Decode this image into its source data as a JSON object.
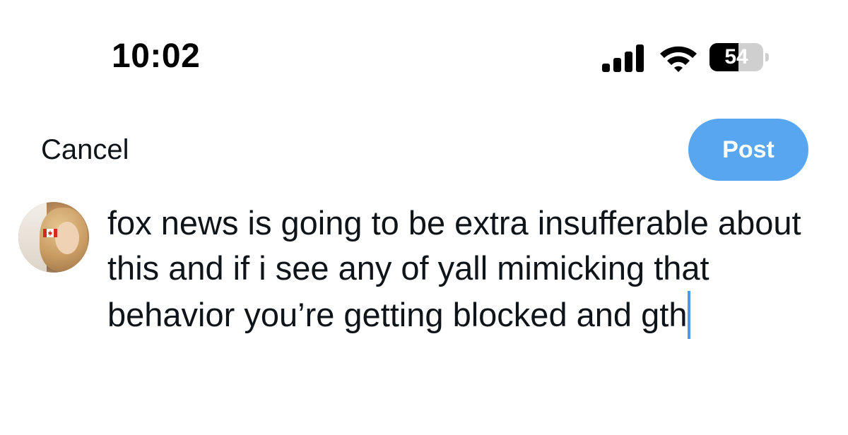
{
  "status_bar": {
    "time": "10:02",
    "battery_level": "54",
    "battery_fraction": 0.54,
    "signal_icon": "cellular-signal-icon",
    "wifi_icon": "wifi-icon"
  },
  "compose": {
    "cancel_label": "Cancel",
    "post_label": "Post",
    "post_button_color": "#58a6ef",
    "text_value": "fox news is going to be extra insufferable about this and if i see any of yall mimicking that behavior you’re getting blocked and gth",
    "cursor_color": "#4a9ae8"
  }
}
